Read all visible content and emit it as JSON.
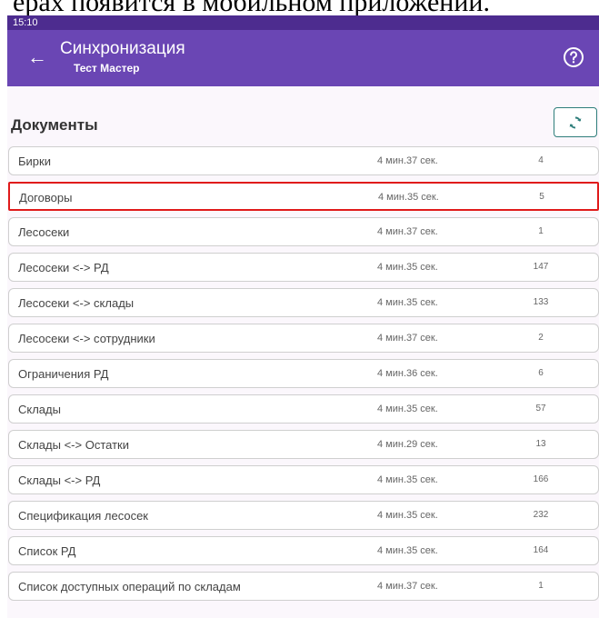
{
  "caption": "ерах появится в мобильном приложении.",
  "status_bar": {
    "time": "15:10"
  },
  "app_bar": {
    "title": "Синхронизация",
    "subtitle": "Тест Мастер",
    "back_icon": "arrow-left-icon",
    "help_icon": "help-circle-icon"
  },
  "section": {
    "title": "Документы",
    "sync_icon": "sync-icon"
  },
  "colors": {
    "status_bar": "#4d2c8f",
    "app_bar": "#6a46b4",
    "background": "#fbf7fc",
    "accent": "#2f7e7b",
    "highlight": "#e01b1b"
  },
  "rows": [
    {
      "name": "Бирки",
      "time": "4 мин.37 сек.",
      "count": "4"
    },
    {
      "name": "Договоры",
      "time": "4 мин.35 сек.",
      "count": "5",
      "highlighted": true
    },
    {
      "name": "Лесосеки",
      "time": "4 мин.37 сек.",
      "count": "1"
    },
    {
      "name": "Лесосеки <-> РД",
      "time": "4 мин.35 сек.",
      "count": "147"
    },
    {
      "name": "Лесосеки <-> склады",
      "time": "4 мин.35 сек.",
      "count": "133"
    },
    {
      "name": "Лесосеки <-> сотрудники",
      "time": "4 мин.37 сек.",
      "count": "2"
    },
    {
      "name": "Ограничения РД",
      "time": "4 мин.36 сек.",
      "count": "6"
    },
    {
      "name": "Склады",
      "time": "4 мин.35 сек.",
      "count": "57"
    },
    {
      "name": "Склады <-> Остатки",
      "time": "4 мин.29 сек.",
      "count": "13"
    },
    {
      "name": "Склады <-> РД",
      "time": "4 мин.35 сек.",
      "count": "166"
    },
    {
      "name": "Спецификация лесосек",
      "time": "4 мин.35 сек.",
      "count": "232"
    },
    {
      "name": "Список РД",
      "time": "4 мин.35 сек.",
      "count": "164"
    },
    {
      "name": "Список доступных операций по складам",
      "time": "4 мин.37 сек.",
      "count": "1"
    }
  ]
}
